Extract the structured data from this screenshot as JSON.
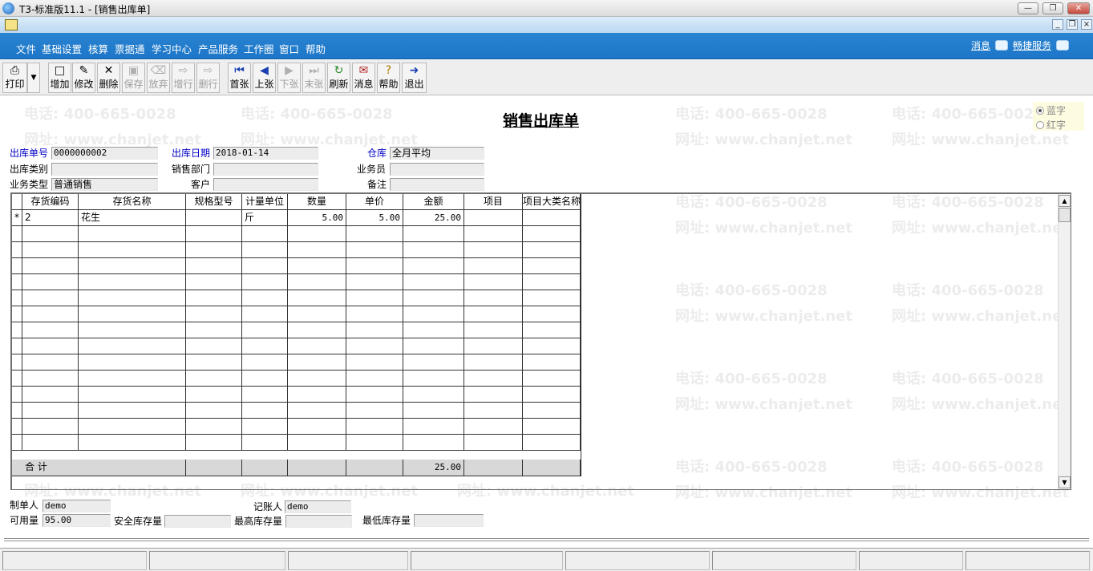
{
  "window": {
    "title": "T3-标准版11.1 - [销售出库单]"
  },
  "menu": [
    "文件",
    "基础设置",
    "核算",
    "票据通",
    "学习中心",
    "产品服务",
    "工作圈",
    "窗口",
    "帮助"
  ],
  "top_links": {
    "messages": "消息",
    "quick_service": "畅捷服务"
  },
  "toolbar": {
    "print": "打印",
    "add": "增加",
    "edit": "修改",
    "delete": "删除",
    "save": "保存",
    "abandon": "放弃",
    "add_row": "增行",
    "delete_row": "删行",
    "first": "首张",
    "prev": "上张",
    "next": "下张",
    "last": "末张",
    "refresh": "刷新",
    "message": "消息",
    "help": "帮助",
    "exit": "退出"
  },
  "watermark": {
    "phone": "电话: 400-665-0028",
    "site": "网址: www.chanjet.net"
  },
  "document": {
    "title": "销售出库单",
    "color_options": {
      "blue": "蓝字",
      "red": "红字",
      "selected": "blue"
    },
    "header": {
      "out_no_label": "出库单号",
      "out_no": "0000000002",
      "out_date_label": "出库日期",
      "out_date": "2018-01-14",
      "warehouse_label": "仓库",
      "warehouse": "全月平均",
      "out_type_label": "出库类别",
      "out_type": "",
      "sales_dept_label": "销售部门",
      "sales_dept": "",
      "salesman_label": "业务员",
      "salesman": "",
      "biz_type_label": "业务类型",
      "biz_type": "普通销售",
      "customer_label": "客户",
      "customer": "",
      "remark_label": "备注",
      "remark": ""
    },
    "grid": {
      "columns": [
        "存货编码",
        "存货名称",
        "规格型号",
        "计量单位",
        "数量",
        "单价",
        "金额",
        "项目",
        "项目大类名称"
      ],
      "rows": [
        {
          "marker": "*",
          "code": "2",
          "name": "花生",
          "spec": "",
          "unit": "斤",
          "qty": "5.00",
          "price": "5.00",
          "amount": "25.00",
          "project": "",
          "category": ""
        }
      ],
      "total_label": "合 计",
      "total_amount": "25.00"
    },
    "footer": {
      "maker_label": "制单人",
      "maker": "demo",
      "bookkeeper_label": "记账人",
      "bookkeeper": "demo",
      "available_label": "可用量",
      "available": "95.00",
      "safety_stock_label": "安全库存量",
      "safety_stock": "",
      "max_stock_label": "最高库存量",
      "max_stock": "",
      "min_stock_label": "最低库存量",
      "min_stock": ""
    }
  },
  "colors": {
    "menubar": "#1d76c8",
    "required_label": "#0000c8"
  }
}
